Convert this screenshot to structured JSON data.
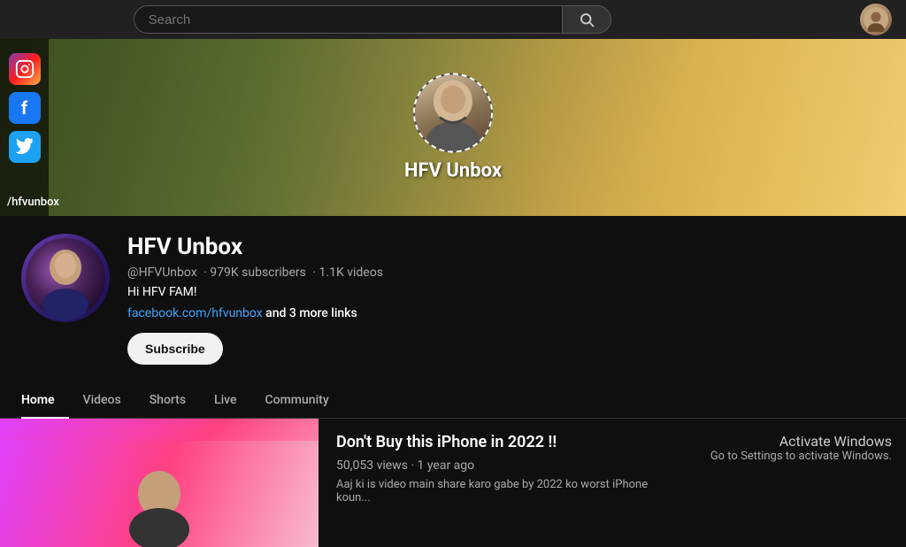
{
  "topbar": {
    "search_placeholder": "Search",
    "search_button_icon": "🔍"
  },
  "banner": {
    "channel_name": "HFV Unbox",
    "handle": "/hfvunbox",
    "social_icons": [
      {
        "name": "instagram",
        "icon": "📷",
        "label": "Instagram"
      },
      {
        "name": "facebook",
        "icon": "f",
        "label": "Facebook"
      },
      {
        "name": "twitter",
        "icon": "🐦",
        "label": "Twitter"
      }
    ]
  },
  "channel": {
    "name": "HFV Unbox",
    "handle": "@HFVUnbox",
    "subscribers": "979K subscribers",
    "videos": "1.1K videos",
    "description": "Hi HFV FAM!",
    "link_text": "facebook.com/hfvunbox",
    "more_links": "and 3 more links",
    "subscribe_label": "Subscribe"
  },
  "tabs": [
    {
      "id": "home",
      "label": "Home",
      "active": true
    },
    {
      "id": "videos",
      "label": "Videos",
      "active": false
    },
    {
      "id": "shorts",
      "label": "Shorts",
      "active": false
    },
    {
      "id": "live",
      "label": "Live",
      "active": false
    },
    {
      "id": "community",
      "label": "Community",
      "active": false
    }
  ],
  "featured_video": {
    "title": "Don't Buy this iPhone in 2022 !!",
    "views": "50,053 views",
    "time_ago": "1 year ago",
    "description": "Aaj ki is video main share karo gabe by 2022 ko worst iPhone koun..."
  },
  "activate_windows": {
    "title": "Activate Windows",
    "subtitle": "Go to Settings to activate Windows."
  }
}
